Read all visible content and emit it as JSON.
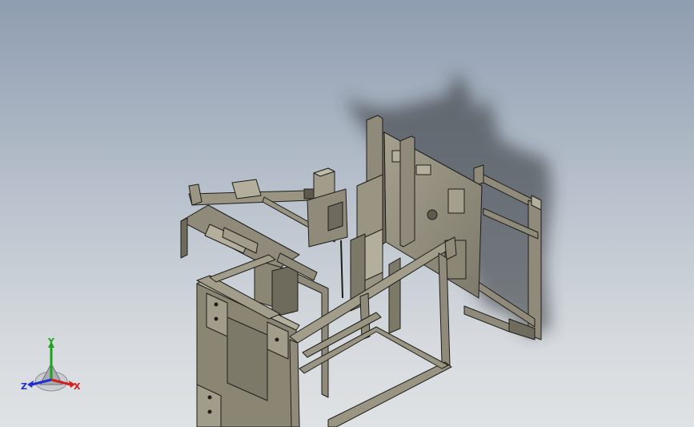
{
  "viewport": {
    "colors": {
      "background_top": "#8e9db0",
      "background_bottom": "#dfe2e5",
      "frame_fill": "#8f8a79",
      "frame_dark": "#5e5a4e",
      "frame_light": "#b4af9c",
      "edge": "#1e1e1a",
      "shadow": "#2b2e33"
    },
    "model": "machine-frame-assembly"
  },
  "triad": {
    "x_label": "X",
    "y_label": "Y",
    "z_label": "Z",
    "x_color": "#d11f1f",
    "y_color": "#1fa31f",
    "z_color": "#1f2fd1"
  }
}
